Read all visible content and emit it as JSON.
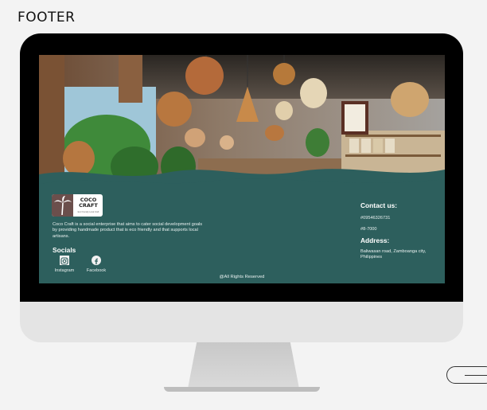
{
  "page": {
    "section_title": "FOOTER"
  },
  "footer": {
    "logo_text_line1": "COCO",
    "logo_text_line2": "CRAFT",
    "logo_tagline": "Eco Friendly Local Craft",
    "description": "Coco Craft is a social enterprise that aims to cater social development goals by providing handmade product that is eco friendly and that supports local artisans.",
    "socials_title": "Socials",
    "socials": [
      {
        "label": "Instagram",
        "icon": "instagram-icon"
      },
      {
        "label": "Facebook",
        "icon": "facebook-icon"
      }
    ],
    "contact_title": "Contact us:",
    "phone": "#09546326731",
    "landline": "#8-7000",
    "address_title": "Address:",
    "address": "Baliwasan road, Zamboanga city, Philippines",
    "copyright": "@All Rights Reserved"
  },
  "colors": {
    "footer_bg": "#2d5f5d",
    "monitor_bezel": "#000000",
    "monitor_chin": "#e4e4e4",
    "logo_brown": "#6b4f4c"
  }
}
